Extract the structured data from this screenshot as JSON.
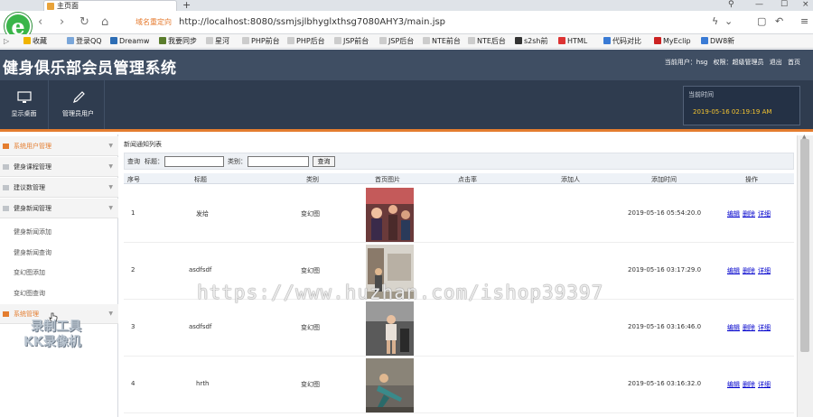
{
  "browser": {
    "tab_title": "主页面",
    "new_tab": "+",
    "domain_tag": "域名重定向",
    "url": "http://localhost:8080/ssmjsjlbhyglxthsg7080AHY3/main.jsp",
    "bookmarks": [
      "收藏",
      "登录QQ",
      "Dreamw",
      "我要同步",
      "星河",
      "PHP前台",
      "PHP后台",
      "JSP前台",
      "JSP后台",
      "NTE前台",
      "NTE后台",
      "s2sh前",
      "HTML",
      "代码对比",
      "MyEclip",
      "DW8新"
    ]
  },
  "app": {
    "title": "健身俱乐部会员管理系统",
    "user_label": "当前用户：hsg",
    "role_label": "权限：超级管理员",
    "logout": "退出",
    "home": "首页",
    "toolbar": [
      {
        "label": "显示桌面",
        "icon": "monitor-icon"
      },
      {
        "label": "管理员用户",
        "icon": "pencil-icon"
      }
    ],
    "time_label": "当前时间",
    "time_value": "2019-05-16 02:19:19 AM"
  },
  "sidebar": {
    "groups": [
      {
        "label": "系统用户管理",
        "active": true
      },
      {
        "label": "健身课程管理"
      },
      {
        "label": "建议数管理"
      },
      {
        "label": "健身新闻管理"
      }
    ],
    "items": [
      "健身新闻添加",
      "健身新闻查询",
      "变幻图添加",
      "变幻图查询"
    ],
    "system_group": "系统管理",
    "stamp_line1": "录制工具",
    "stamp_line2": "KK录像机"
  },
  "main": {
    "breadcrumb": "新闻通知列表",
    "query_label": "查询",
    "title_label": "标题：",
    "category_label": "类别：",
    "search_button": "查询",
    "columns": [
      "序号",
      "标题",
      "类别",
      "首页图片",
      "点击率",
      "添加人",
      "添加时间",
      "操作"
    ],
    "rows": [
      {
        "id": "1",
        "title": "发给",
        "category": "变幻图",
        "time": "2019-05-16 05:54:20.0"
      },
      {
        "id": "2",
        "title": "asdfsdf",
        "category": "变幻图",
        "time": "2019-05-16 03:17:29.0"
      },
      {
        "id": "3",
        "title": "asdfsdf",
        "category": "变幻图",
        "time": "2019-05-16 03:16:46.0"
      },
      {
        "id": "4",
        "title": "hrth",
        "category": "变幻图",
        "time": "2019-05-16 03:16:32.0"
      }
    ],
    "actions": [
      "编辑",
      "删除",
      "详细"
    ]
  },
  "watermark": "https://www.huzhan.com/ishop39397",
  "colors": {
    "header": "#3f4e63",
    "toolbar": "#2f3c4f",
    "accent": "#e47d2f",
    "time": "#f4c430"
  }
}
